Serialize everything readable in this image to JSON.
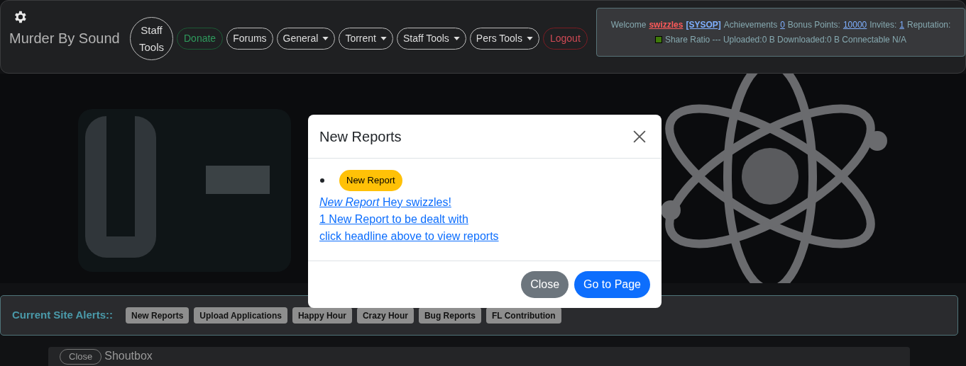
{
  "header": {
    "title": "Murder By Sound",
    "nav": [
      {
        "label": "Staff Tools",
        "kind": "circle"
      },
      {
        "label": "Donate",
        "kind": "success"
      },
      {
        "label": "Forums",
        "kind": "plain"
      },
      {
        "label": "General",
        "kind": "dropdown"
      },
      {
        "label": "Torrent",
        "kind": "dropdown"
      },
      {
        "label": "Staff Tools",
        "kind": "dropdown"
      },
      {
        "label": "Pers Tools",
        "kind": "dropdown"
      },
      {
        "label": "Logout",
        "kind": "danger"
      }
    ]
  },
  "user_panel": {
    "line_1": [
      {
        "text": "Welcome",
        "kind": "text"
      },
      {
        "text": "swizzles",
        "kind": "user"
      },
      {
        "text": "[SYSOP]",
        "kind": "role"
      },
      {
        "text": "Achievements",
        "kind": "text"
      },
      {
        "text": "0",
        "kind": "link"
      },
      {
        "text": "Bonus Points:",
        "kind": "text"
      },
      {
        "text": "10000",
        "kind": "link"
      },
      {
        "text": "Invites:",
        "kind": "text"
      },
      {
        "text": "1",
        "kind": "link"
      },
      {
        "text": "Reputation:",
        "kind": "text"
      }
    ],
    "line_2": "Share Ratio --- Uploaded:0 B Downloaded:0 B Connectable N/A"
  },
  "site_alerts": {
    "title": "Current Site Alerts::",
    "items": [
      "New Reports",
      "Upload Applications",
      "Happy Hour",
      "Crazy Hour",
      "Bug Reports",
      "FL Contribution"
    ]
  },
  "shoutbox": {
    "close_label": "Close",
    "title": "Shoutbox"
  },
  "modal": {
    "title": "New Reports",
    "badge": "New Report",
    "lines": [
      "*New Report* Hey swizzles!",
      "1 New Report to be dealt with",
      "click headline above to view reports"
    ],
    "buttons": [
      {
        "label": "Close",
        "kind": "secondary"
      },
      {
        "label": "Go to Page",
        "kind": "primary"
      }
    ]
  }
}
